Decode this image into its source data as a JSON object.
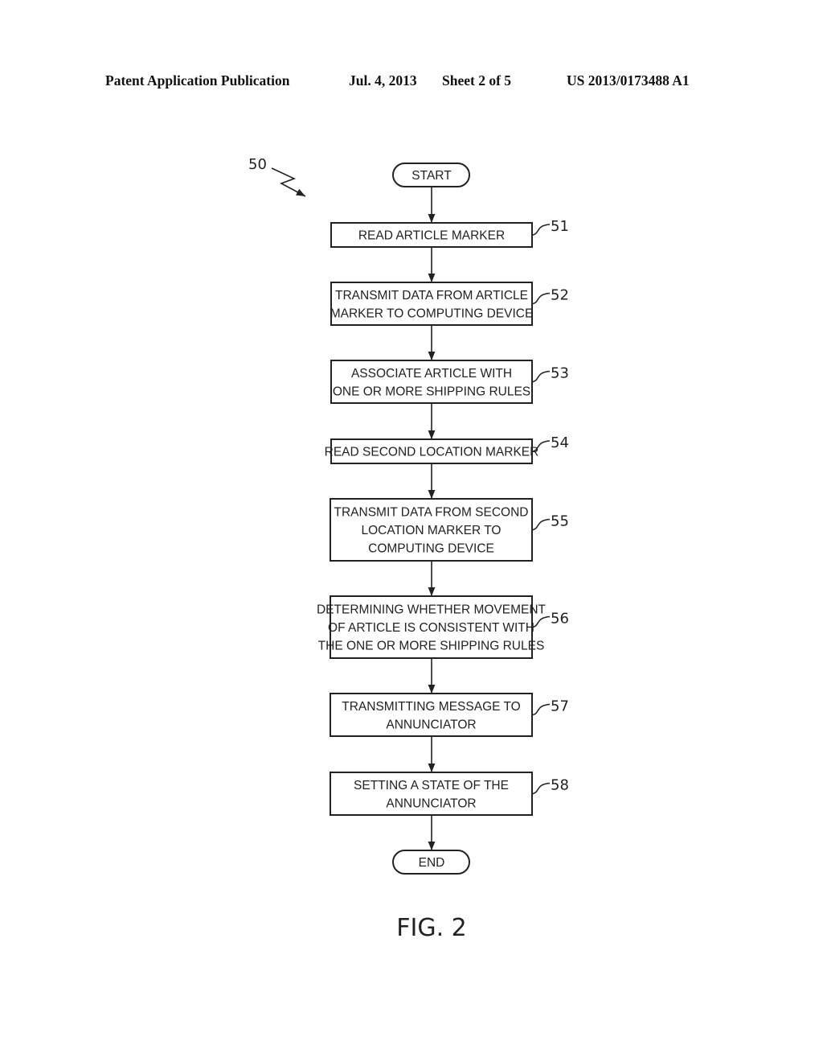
{
  "header": {
    "title": "Patent Application Publication",
    "date": "Jul. 4, 2013",
    "sheet": "Sheet 2 of 5",
    "number": "US 2013/0173488 A1"
  },
  "diagram": {
    "ref_main": "50",
    "start_label": "START",
    "end_label": "END",
    "steps": [
      {
        "ref": "51",
        "lines": [
          "READ ARTICLE MARKER"
        ]
      },
      {
        "ref": "52",
        "lines": [
          "TRANSMIT DATA FROM ARTICLE",
          "MARKER TO COMPUTING DEVICE"
        ]
      },
      {
        "ref": "53",
        "lines": [
          "ASSOCIATE ARTICLE WITH",
          "ONE OR MORE SHIPPING RULES"
        ]
      },
      {
        "ref": "54",
        "lines": [
          "READ SECOND LOCATION MARKER"
        ]
      },
      {
        "ref": "55",
        "lines": [
          "TRANSMIT DATA FROM SECOND",
          "LOCATION MARKER TO",
          "COMPUTING DEVICE"
        ]
      },
      {
        "ref": "56",
        "lines": [
          "DETERMINING WHETHER MOVEMENT",
          "OF ARTICLE IS CONSISTENT WITH",
          "THE ONE OR MORE SHIPPING RULES"
        ]
      },
      {
        "ref": "57",
        "lines": [
          "TRANSMITTING MESSAGE TO",
          "ANNUNCIATOR"
        ]
      },
      {
        "ref": "58",
        "lines": [
          "SETTING A STATE OF THE",
          "ANNUNCIATOR"
        ]
      }
    ],
    "figure_label": "FIG. 2"
  }
}
